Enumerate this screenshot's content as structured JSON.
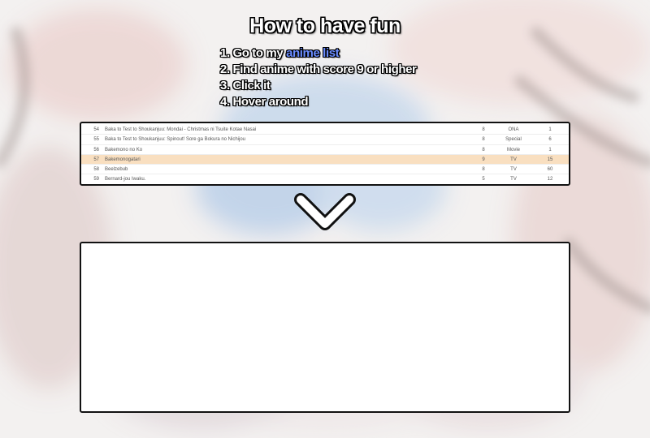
{
  "title": "How to have fun",
  "steps": {
    "step1_prefix": "1. Go to my ",
    "step1_link": "anime list",
    "step2": "2. Find anime with score 9 or higher",
    "step3": "3. Click it",
    "step4": "4. Hover around"
  },
  "anime_list": {
    "rows": [
      {
        "num": "54",
        "title": "Baka to Test to Shoukanjuu: Mondai - Christmas ni Tsuite Kotae Nasai",
        "score": "8",
        "type": "ONA",
        "eps": "1",
        "highlighted": false
      },
      {
        "num": "55",
        "title": "Baka to Test to Shoukanjuu: Spinout! Sore ga Bokura no Nichijou",
        "score": "8",
        "type": "Special",
        "eps": "6",
        "highlighted": false
      },
      {
        "num": "56",
        "title": "Bakemono no Ko",
        "score": "8",
        "type": "Movie",
        "eps": "1",
        "highlighted": false
      },
      {
        "num": "57",
        "title": "Bakemonogatari",
        "score": "9",
        "type": "TV",
        "eps": "15",
        "highlighted": true
      },
      {
        "num": "58",
        "title": "Beelzebub",
        "score": "8",
        "type": "TV",
        "eps": "60",
        "highlighted": false
      },
      {
        "num": "59",
        "title": "Bernard-jou Iwaku.",
        "score": "5",
        "type": "TV",
        "eps": "12",
        "highlighted": false
      }
    ]
  },
  "icons": {
    "arrow": "chevron-down-icon"
  },
  "colors": {
    "link": "#6a8cff",
    "highlight_row": "#f9dfc0",
    "background": "#f0eded"
  }
}
